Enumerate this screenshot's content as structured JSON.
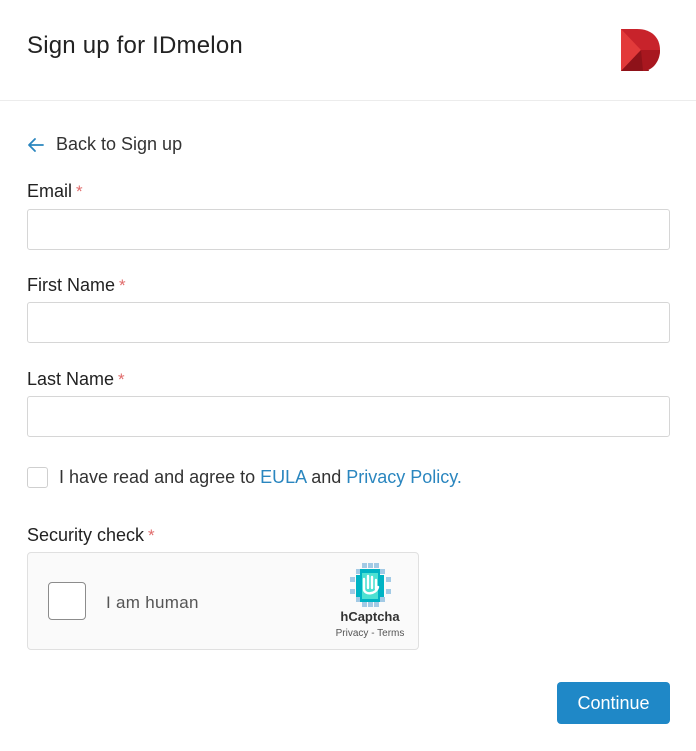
{
  "header": {
    "title": "Sign up for IDmelon",
    "logo_icon": "idmelon-logo-icon",
    "brand_color": "#c8232b"
  },
  "back": {
    "label": "Back to Sign up",
    "icon": "arrow-left-icon"
  },
  "form": {
    "required_marker": "*",
    "email": {
      "label": "Email",
      "value": "",
      "placeholder": ""
    },
    "first_name": {
      "label": "First Name",
      "value": "",
      "placeholder": ""
    },
    "last_name": {
      "label": "Last Name",
      "value": "",
      "placeholder": ""
    },
    "agree": {
      "checked": false,
      "text_before": "I have read and agree to ",
      "eula_link": "EULA",
      "text_middle": " and ",
      "privacy_link": "Privacy Policy."
    },
    "security_label": "Security check"
  },
  "captcha": {
    "label": "I am human",
    "brand": "hCaptcha",
    "privacy": "Privacy",
    "separator": " - ",
    "terms": "Terms",
    "icon": "hcaptcha-hand-icon"
  },
  "actions": {
    "continue_label": "Continue",
    "accent_color": "#1f88c7"
  }
}
